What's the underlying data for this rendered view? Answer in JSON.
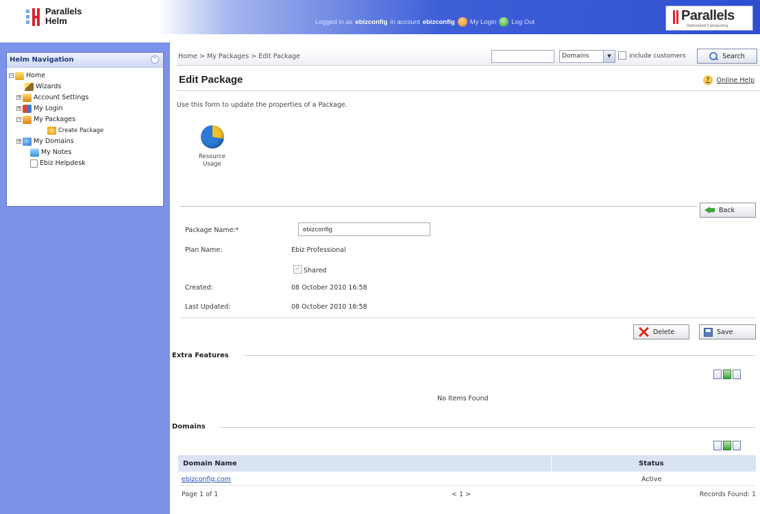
{
  "header": {
    "brand_line1": "Parallels",
    "brand_line2": "Helm",
    "logged_in_as_label": "Logged in as",
    "logged_in_user": "ebizconfig",
    "in_account_label": "in account",
    "account_name": "ebizconfig",
    "my_login_label": "My Login",
    "log_out_label": "Log Out",
    "logo_word": "Parallels",
    "logo_sub": "Optimized Computing"
  },
  "sidebar": {
    "title": "Helm Navigation",
    "items": [
      {
        "label": "Home",
        "icon": "home-icon"
      },
      {
        "label": "Wizards",
        "icon": "wizard-icon"
      },
      {
        "label": "Account Settings",
        "icon": "settings-icon"
      },
      {
        "label": "My Login",
        "icon": "user-icon"
      },
      {
        "label": "My Packages",
        "icon": "package-icon"
      },
      {
        "label": "Create Package",
        "icon": "create-package-icon"
      },
      {
        "label": "My Domains",
        "icon": "domains-icon"
      },
      {
        "label": "My Notes",
        "icon": "notes-icon"
      },
      {
        "label": "Ebiz Helpdesk",
        "icon": "document-icon"
      }
    ]
  },
  "toolbar": {
    "breadcrumb": "Home > My Packages > Edit Package",
    "search_value": "",
    "scope_select": "Domains",
    "include_customers_label": "include customers",
    "search_button": "Search"
  },
  "page": {
    "title": "Edit Package",
    "help_label": "Online Help",
    "intro": "Use this form to update the properties of a Package.",
    "resource_usage_label": "Resource Usage",
    "back_button": "Back"
  },
  "form": {
    "package_name_label": "Package Name:*",
    "package_name_value": "ebizconfig",
    "plan_name_label": "Plan Name:",
    "plan_name_value": "Ebiz Professional",
    "shared_label": "Shared",
    "created_label": "Created:",
    "created_value": "08 October 2010 16:58",
    "last_updated_label": "Last Updated:",
    "last_updated_value": "08 October 2010 16:58",
    "delete_button": "Delete",
    "save_button": "Save"
  },
  "extra_features": {
    "title": "Extra Features",
    "empty_text": "No Items Found"
  },
  "domains": {
    "title": "Domains",
    "columns": [
      "Domain Name",
      "Status"
    ],
    "rows": [
      {
        "name": "ebizconfig.com",
        "status": "Active"
      }
    ],
    "page_info": "Page 1 of 1",
    "pager": "< 1 >",
    "records_found": "Records Found: 1"
  },
  "colors": {
    "sidebar_bg": "#7d92ea",
    "header_blue": "#2f4fd0",
    "accent_red": "#d9232e",
    "table_header_bg": "#d9e3f3",
    "link": "#2a4fb0"
  }
}
